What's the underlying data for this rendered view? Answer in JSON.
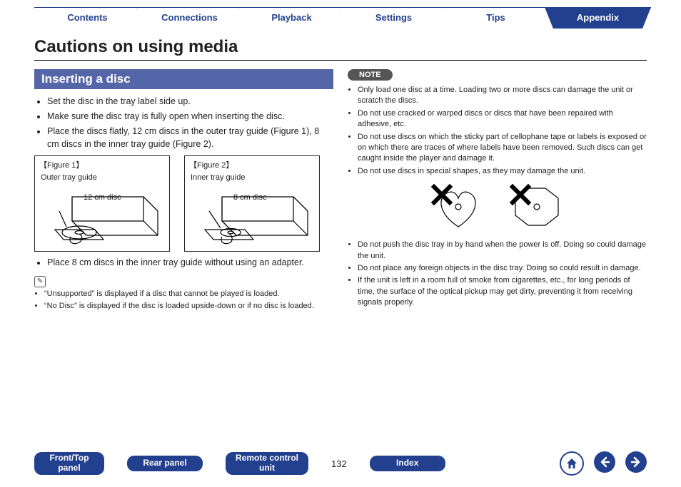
{
  "tabs": [
    "Contents",
    "Connections",
    "Playback",
    "Settings",
    "Tips",
    "Appendix"
  ],
  "active_tab_index": 5,
  "page_title": "Cautions on using media",
  "section_title": "Inserting a disc",
  "left_bullets_a": [
    "Set the disc in the tray label side up.",
    "Make sure the disc tray is fully open when inserting the disc.",
    "Place the discs flatly, 12 cm discs in the outer tray guide (Figure 1), 8 cm discs in the inner tray guide (Figure 2)."
  ],
  "fig1": {
    "caption": "【Figure 1】",
    "guide": "Outer tray guide",
    "disc": "12 cm disc"
  },
  "fig2": {
    "caption": "【Figure 2】",
    "guide": "Inner tray guide",
    "disc": "8 cm disc"
  },
  "left_bullets_b": [
    "Place 8 cm discs in the inner tray guide without using an adapter."
  ],
  "left_bullets_c": [
    "“Unsupported” is displayed if a disc that cannot be played is loaded.",
    "“No Disc” is displayed if the disc is loaded upside-down or if no disc is loaded."
  ],
  "note_label": "NOTE",
  "note_bullets_a": [
    "Only load one disc at a time. Loading two or more discs can damage the unit or scratch the discs.",
    "Do not use cracked or warped discs or discs that have been repaired with adhesive, etc.",
    "Do not use discs on which the sticky part of cellophane tape or labels is exposed or on which there are traces of where labels have been removed. Such discs can get caught inside the player and damage it.",
    "Do not use discs in special shapes, as they may damage the unit."
  ],
  "note_bullets_b": [
    "Do not push the disc tray in by hand when the power is off. Doing so could damage the unit.",
    "Do not place any foreign objects in the disc tray. Doing so could result in damage.",
    "If the unit is left in a room full of smoke from cigarettes, etc., for long periods of time, the surface of the optical pickup may get dirty, preventing it from receiving signals properly."
  ],
  "footer_tabs": [
    "Front/Top\npanel",
    "Rear panel",
    "Remote control\nunit"
  ],
  "page_number": "132",
  "index_label": "Index",
  "nav": {
    "home": "home-icon",
    "prev": "arrow-left-icon",
    "next": "arrow-right-icon"
  }
}
